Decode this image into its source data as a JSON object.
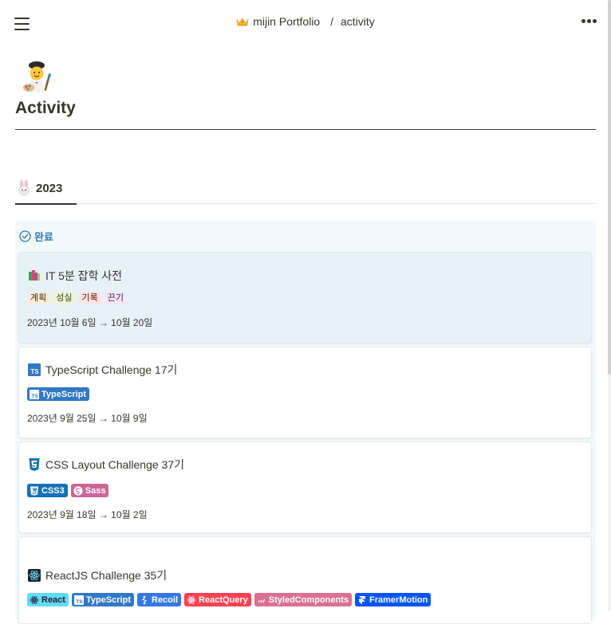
{
  "topbar": {
    "breadcrumb": [
      {
        "label": "mijin Portfolio",
        "icon": "crown-icon"
      },
      {
        "label": "activity"
      }
    ],
    "separator": "/"
  },
  "page": {
    "icon": "artist-emoji-icon",
    "title": "Activity"
  },
  "section": {
    "icon": "rabbit-emoji-icon",
    "year": "2023"
  },
  "board": {
    "group_label": "완료",
    "group_icon": "check-circle-icon",
    "accent_color": "#2e7ab0",
    "cards": [
      {
        "title": "IT 5분 잡학 사전",
        "icon": "books-icon",
        "tags": [
          {
            "label": "계획",
            "color": "#fbecdd"
          },
          {
            "label": "성실",
            "color": "#eef3da"
          },
          {
            "label": "기록",
            "color": "#fde4e3"
          },
          {
            "label": "끈기",
            "color": "#f2e7f6"
          }
        ],
        "date": "2023년 10월 6일 → 10월 20일"
      },
      {
        "title": "TypeScript Challenge 17기",
        "icon": "typescript-icon",
        "badges": [
          {
            "label": "TypeScript",
            "color": "#3178c6",
            "icon": "typescript-icon"
          }
        ],
        "date": "2023년 9월 25일 → 10월 9일"
      },
      {
        "title": "CSS Layout Challenge 37기",
        "icon": "css3-icon",
        "badges": [
          {
            "label": "CSS3",
            "color": "#1572b6",
            "icon": "css3-icon"
          },
          {
            "label": "Sass",
            "color": "#cc6699",
            "icon": "sass-icon"
          }
        ],
        "date": "2023년 9월 18일 → 10월 2일"
      },
      {
        "title": "ReactJS Challenge 35기",
        "icon": "react-icon",
        "badges": [
          {
            "label": "React",
            "color": "#61dafb",
            "icon": "react-icon"
          },
          {
            "label": "TypeScript",
            "color": "#3178c6",
            "icon": "typescript-icon"
          },
          {
            "label": "Recoil",
            "color": "#3578e5",
            "icon": "recoil-icon"
          },
          {
            "label": "ReactQuery",
            "color": "#ff4154",
            "icon": "react-query-icon"
          },
          {
            "label": "StyledComponents",
            "color": "#db7093",
            "icon": "styled-components-icon"
          },
          {
            "label": "FramerMotion",
            "color": "#0055ff",
            "icon": "framer-icon"
          }
        ]
      }
    ]
  }
}
